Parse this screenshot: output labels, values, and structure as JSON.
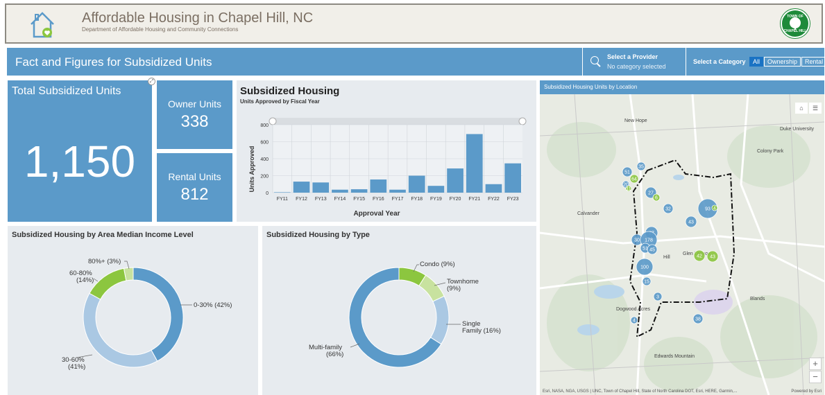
{
  "header": {
    "title": "Affordable Housing in Chapel Hill, NC",
    "subtitle": "Department of Affordable Housing and Community Connections",
    "seal_top": "TOWN OF",
    "seal_bottom": "CHAPEL HILL"
  },
  "topbar": {
    "title": "Fact and Figures for Subsidized Units",
    "provider_label": "Select a Provider",
    "provider_value": "No category selected",
    "category_label": "Select a Category",
    "categories": [
      "All",
      "Ownership",
      "Rental"
    ],
    "active_category": "All"
  },
  "kpis": {
    "total_label": "Total Subsidized Units",
    "total_value": "1,150",
    "owner_label": "Owner Units",
    "owner_value": "338",
    "rental_label": "Rental Units",
    "rental_value": "812"
  },
  "bar_panel": {
    "title": "Subsidized Housing",
    "subtitle": "Units Approved by Fiscal Year"
  },
  "pie_ami": {
    "title": "Subsidized Housing by Area Median Income Level",
    "labels": [
      "0-30% (42%)",
      "30-60%",
      "(41%)",
      "60-80%",
      "(14%)",
      "80%+ (3%)"
    ]
  },
  "pie_type": {
    "title": "Subsidized Housing by Type",
    "labels": [
      "Condo (9%)",
      "Townhome",
      "(9%)",
      "Single",
      "Family (16%)",
      "Multi-family",
      "(66%)"
    ]
  },
  "map": {
    "header": "Subsidized Housing Units by Location",
    "attribution": "Esri, NASA, NGA, USGS | UNC, Town of Chapel Hill, State of North Carolina DOT, Esri, HERE, Garmin,...",
    "powered": "Powered by Esri",
    "places": [
      "New Hope",
      "Duke University",
      "Colony Park",
      "Calvander",
      "Glen Lennox",
      "Blands",
      "Dogwood Acres",
      "Edwards Mountain",
      "Hill"
    ],
    "clusters": [
      "93",
      "43",
      "38",
      "27",
      "32",
      "27",
      "30",
      "178",
      "51",
      "45",
      "100",
      "15",
      "3",
      "4",
      "35",
      "51",
      "20",
      "64",
      "11",
      "6",
      "42",
      "43",
      "4"
    ],
    "zoom_in": "+",
    "zoom_out": "−"
  },
  "chart_data": [
    {
      "type": "bar",
      "title": "Subsidized Housing",
      "subtitle": "Units Approved by Fiscal Year",
      "xlabel": "Approval Year",
      "ylabel": "Units Approved",
      "categories": [
        "FY11",
        "FY12",
        "FY13",
        "FY14",
        "FY15",
        "FY16",
        "FY17",
        "FY18",
        "FY19",
        "FY20",
        "FY21",
        "FY22",
        "FY23"
      ],
      "values": [
        5,
        130,
        120,
        35,
        40,
        155,
        35,
        200,
        80,
        285,
        690,
        100,
        345
      ],
      "ylim": [
        0,
        800
      ],
      "yticks": [
        0,
        200,
        400,
        600,
        800
      ],
      "color": "#5b9ac9"
    },
    {
      "type": "pie",
      "title": "Subsidized Housing by Area Median Income Level",
      "categories": [
        "0-30%",
        "30-60%",
        "60-80%",
        "80%+"
      ],
      "values": [
        42,
        41,
        14,
        3
      ],
      "colors": [
        "#5b9ac9",
        "#aac8e3",
        "#8cc63f",
        "#c8e29f"
      ]
    },
    {
      "type": "pie",
      "title": "Subsidized Housing by Type",
      "categories": [
        "Condo",
        "Townhome",
        "Single Family",
        "Multi-family"
      ],
      "values": [
        9,
        9,
        16,
        66
      ],
      "colors": [
        "#8cc63f",
        "#c8e29f",
        "#aac8e3",
        "#5b9ac9"
      ]
    }
  ]
}
